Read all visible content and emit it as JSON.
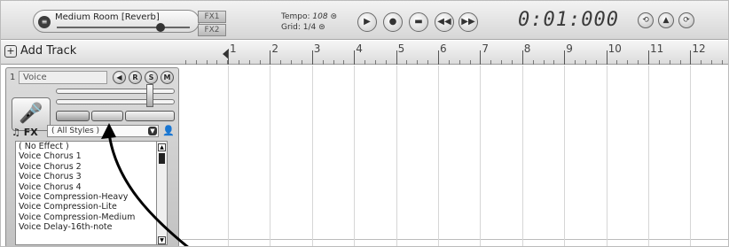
{
  "topbar": {
    "preset_name": "Medium Room [Reverb]",
    "fx1": "FX1",
    "fx2": "FX2",
    "tempo_label": "Tempo:",
    "tempo_value": "108",
    "grid_label": "Grid:",
    "grid_value": "1/4",
    "time": "0:01:000"
  },
  "toolbar": {
    "add_track_label": "Add Track"
  },
  "ruler": {
    "bars": [
      "1",
      "2",
      "3",
      "4",
      "5",
      "6",
      "7",
      "8",
      "9",
      "10",
      "11",
      "12"
    ]
  },
  "track": {
    "number": "1",
    "name": "Voice",
    "buttons": [
      "◀",
      "R",
      "S",
      "M"
    ],
    "fx_label": "FX",
    "style_filter": "( All Styles )",
    "effects": [
      "( No Effect )",
      "Voice Chorus 1",
      "Voice Chorus 2",
      "Voice Chorus 3",
      "Voice Chorus 4",
      "Voice Compression-Heavy",
      "Voice Compression-Lite",
      "Voice Compression-Medium",
      "Voice Delay-16th-note"
    ]
  },
  "colors": {
    "panel_bg": "#c8c8c8",
    "arrow": "#000000"
  }
}
